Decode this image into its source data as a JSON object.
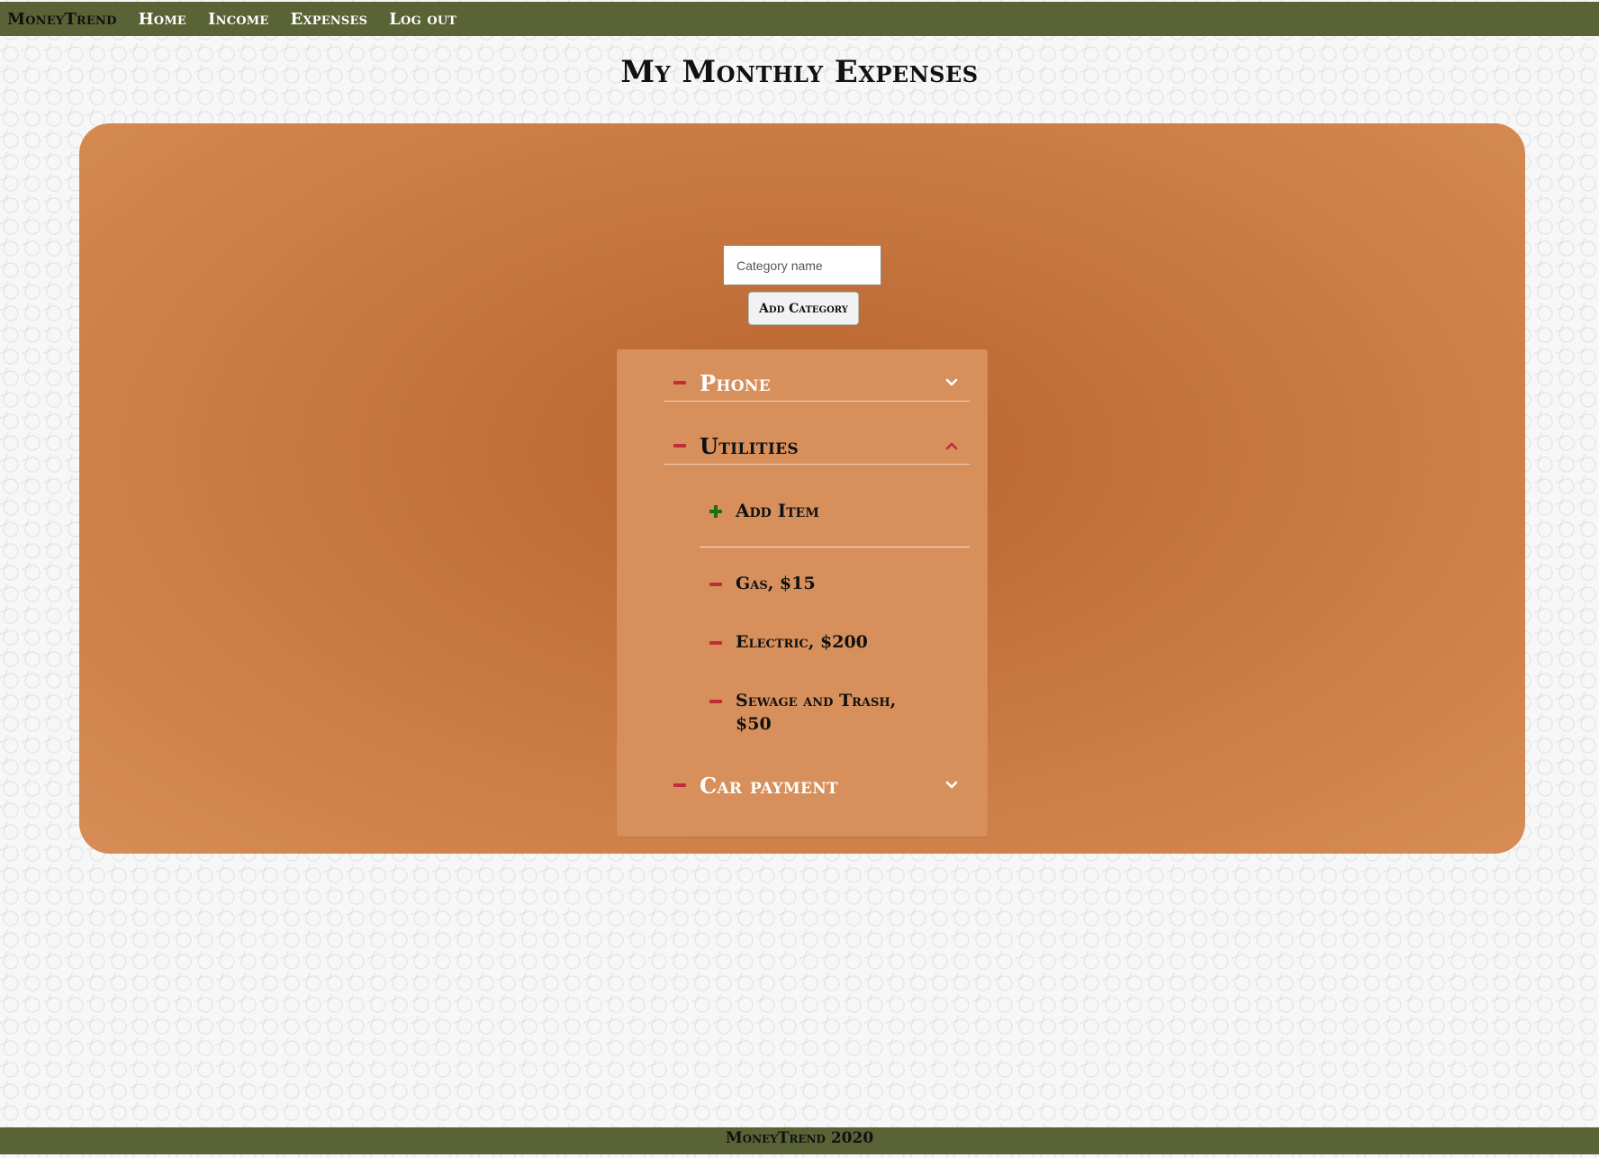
{
  "nav": {
    "brand": "MoneyTrend",
    "links": [
      "Home",
      "Income",
      "Expenses",
      "Log out"
    ]
  },
  "page": {
    "title": "My Monthly Expenses"
  },
  "add_category": {
    "placeholder": "Category name",
    "value": "",
    "button_label": "Add Category"
  },
  "categories": [
    {
      "name": "Phone",
      "expanded": false,
      "remove_icon": "minus-icon",
      "toggle_icon": "chevron-down-icon"
    },
    {
      "name": "Utilities",
      "expanded": true,
      "remove_icon": "minus-icon",
      "toggle_icon": "chevron-up-icon",
      "add_item_label": "Add Item",
      "items": [
        {
          "label": "Gas, $15"
        },
        {
          "label": "Electric, $200"
        },
        {
          "label": "Sewage and Trash, $50"
        }
      ]
    },
    {
      "name": "Car payment",
      "expanded": false,
      "remove_icon": "minus-icon",
      "toggle_icon": "chevron-down-icon"
    }
  ],
  "footer": {
    "text": "MoneyTrend 2020"
  },
  "colors": {
    "nav_bg": "#596336",
    "panel": "#c6773f",
    "accordion_bg": "#d78f5b",
    "remove_red": "#c12c3c",
    "add_green": "#1f6b16"
  }
}
